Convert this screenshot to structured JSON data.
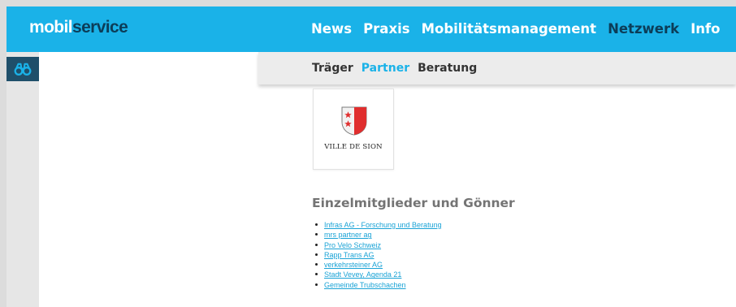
{
  "brand": {
    "part1": "mobil",
    "part2": "service",
    "color_primary": "#1ab2e8",
    "color_dark": "#0c3d58"
  },
  "main_nav": {
    "items": [
      {
        "label": "News",
        "active": false
      },
      {
        "label": "Praxis",
        "active": false
      },
      {
        "label": "Mobilitätsmanagement",
        "active": false
      },
      {
        "label": "Netzwerk",
        "active": true
      },
      {
        "label": "Info",
        "active": false
      }
    ]
  },
  "sidebar": {
    "icon": "binoculars-icon"
  },
  "sub_nav": {
    "items": [
      {
        "label": "Träger",
        "active": false
      },
      {
        "label": "Partner",
        "active": true
      },
      {
        "label": "Beratung",
        "active": false
      }
    ]
  },
  "partner_logo": {
    "caption": "VILLE DE SION",
    "icon": "sion-coat-of-arms-icon"
  },
  "members_section": {
    "title": "Einzelmitglieder und Gönner",
    "items": [
      "Infras AG - Forschung und Beratung",
      "mrs partner ag",
      "Pro Velo Schweiz",
      "Rapp Trans AG",
      "verkehrsteiner AG",
      "Stadt Vevey, Agenda 21",
      "Gemeinde Trubschachen"
    ]
  }
}
